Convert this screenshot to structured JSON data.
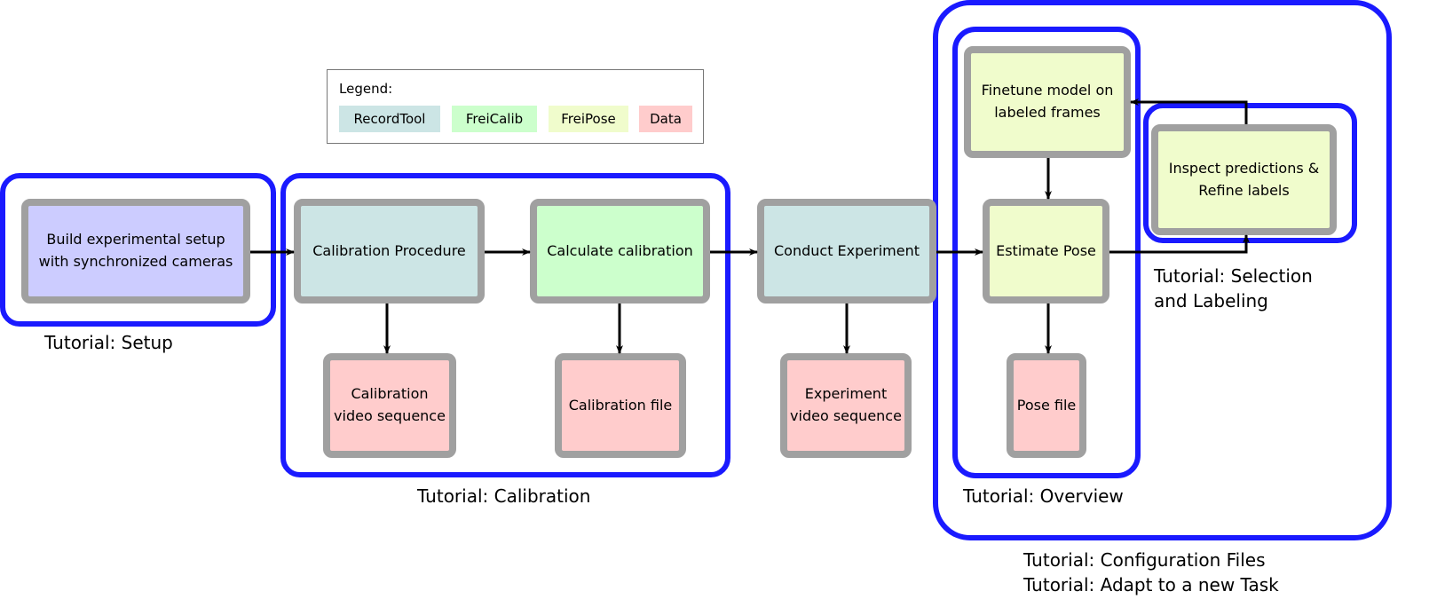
{
  "colors": {
    "group_border": "#1a1aff",
    "node_border": "#a0a0a0",
    "setup": "#ccccff",
    "recordtool": "#cce5e5",
    "freicalib": "#ccffcc",
    "freipose": "#f0fccc",
    "data": "#ffcccc"
  },
  "legend": {
    "title": "Legend:",
    "items": [
      {
        "label": "RecordTool",
        "color": "#cce5e5"
      },
      {
        "label": "FreiCalib",
        "color": "#ccffcc"
      },
      {
        "label": "FreiPose",
        "color": "#f0fccc"
      },
      {
        "label": "Data",
        "color": "#ffcccc"
      }
    ]
  },
  "nodes": {
    "build": "Build experimental setup\nwith synchronized cameras",
    "calib_proc": "Calibration Procedure",
    "calc_calib": "Calculate calibration",
    "conduct": "Conduct Experiment",
    "estimate": "Estimate Pose",
    "finetune": "Finetune model on\nlabeled frames",
    "inspect": "Inspect predictions &\nRefine labels",
    "calib_video": "Calibration\nvideo sequence",
    "calib_file": "Calibration file",
    "exp_video": "Experiment\nvideo sequence",
    "pose_file": "Pose file"
  },
  "groups": {
    "setup": "Tutorial: Setup",
    "calibration": "Tutorial: Calibration",
    "overview": "Tutorial: Overview",
    "selection": "Tutorial: Selection\nand Labeling",
    "config": "Tutorial: Configuration Files\nTutorial: Adapt to a new Task"
  }
}
